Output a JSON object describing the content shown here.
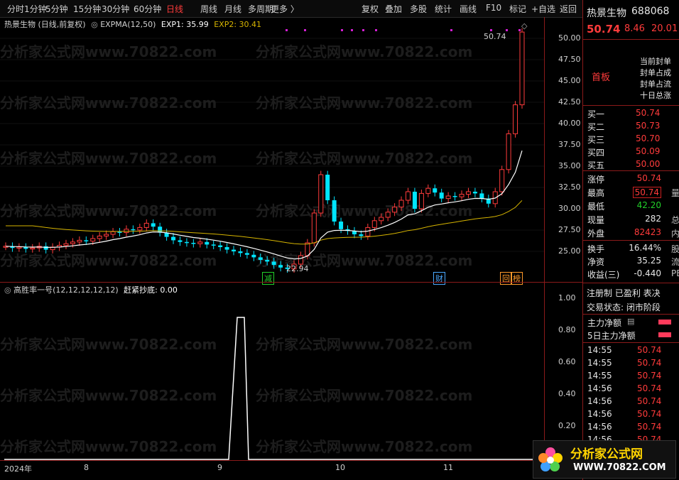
{
  "toolbar": {
    "periods": [
      "分时",
      "1分钟",
      "5分钟",
      "15分钟",
      "30分钟",
      "60分钟",
      "日线",
      "周线",
      "月线",
      "多周期",
      "更多 〉"
    ],
    "active_index": 6,
    "actions": [
      "复权",
      "叠加",
      "多股",
      "统计",
      "画线",
      "F10",
      "标记",
      "+自选",
      "返回"
    ]
  },
  "main_legend": {
    "title": "热景生物 (日线,前复权)",
    "indicator": "EXPMA(12,50)",
    "exp1": "EXP1: 35.99",
    "exp2": "EXP2: 30.41"
  },
  "sub_legend": {
    "title": "高胜率一号(12,12,12,12,12)",
    "value": "赶紧抄底: 0.00"
  },
  "watermark": "分析家公式网www.70822.com",
  "price_axis": [
    "50.00",
    "47.50",
    "45.00",
    "42.50",
    "40.00",
    "37.50",
    "35.00",
    "32.50",
    "30.00",
    "27.50",
    "25.00"
  ],
  "sub_axis": [
    "1.00",
    "0.80",
    "0.60",
    "0.40",
    "0.20"
  ],
  "x_axis": [
    "2024年",
    "8",
    "9",
    "10",
    "11"
  ],
  "annotations": {
    "high_label": "50.74",
    "low_label": "22.94"
  },
  "markers": [
    {
      "label": "减",
      "color": "#22d02a"
    },
    {
      "label": "财",
      "color": "#4aa8ff"
    },
    {
      "label": "回",
      "color": "#ff9a2a"
    },
    {
      "label": "榜",
      "color": "#ff9a2a"
    }
  ],
  "quote": {
    "name": "热景生物",
    "code": "688068",
    "price": "50.74",
    "change": "8.46",
    "pct": "20.01",
    "board_tag": "首板",
    "notes": [
      "当前封单",
      "封单占成",
      "封单占流",
      "十日总涨"
    ],
    "bids": [
      {
        "label": "买一",
        "value": "50.74"
      },
      {
        "label": "买二",
        "value": "50.73"
      },
      {
        "label": "买三",
        "value": "50.70"
      },
      {
        "label": "买四",
        "value": "50.09"
      },
      {
        "label": "买五",
        "value": "50.00"
      }
    ],
    "stats": [
      {
        "label": "涨停",
        "value": "50.74",
        "extra": ""
      },
      {
        "label": "最高",
        "value": "50.74",
        "extra": "量"
      },
      {
        "label": "最低",
        "value": "42.20",
        "extra": ""
      },
      {
        "label": "现量",
        "value": "282",
        "extra": "总"
      },
      {
        "label": "外盘",
        "value": "82423",
        "extra": "内"
      }
    ],
    "stats2": [
      {
        "label": "换手",
        "value": "16.44%",
        "extra": "股"
      },
      {
        "label": "净资",
        "value": "35.25",
        "extra": "流"
      },
      {
        "label": "收益(三)",
        "value": "-0.440",
        "extra": "PE"
      }
    ],
    "flags": "注册制  已盈利  表决",
    "status": "交易状态: 闭市阶段",
    "flow": [
      {
        "label": "主力净额"
      },
      {
        "label": "5日主力净额"
      }
    ],
    "ticks": [
      {
        "time": "14:55",
        "price": "50.74"
      },
      {
        "time": "14:55",
        "price": "50.74"
      },
      {
        "time": "14:55",
        "price": "50.74"
      },
      {
        "time": "14:56",
        "price": "50.74"
      },
      {
        "time": "14:56",
        "price": "50.74"
      },
      {
        "time": "14:56",
        "price": "50.74"
      },
      {
        "time": "14:56",
        "price": "50.74"
      },
      {
        "time": "14:56",
        "price": "50.74"
      }
    ]
  },
  "logo": {
    "name": "分析家公式网",
    "url": "WWW.70822.COM"
  },
  "colors": {
    "up": "#ff3b3b",
    "down": "#00e5ff",
    "exp1": "#ffffff",
    "exp2": "#d6b400"
  }
}
